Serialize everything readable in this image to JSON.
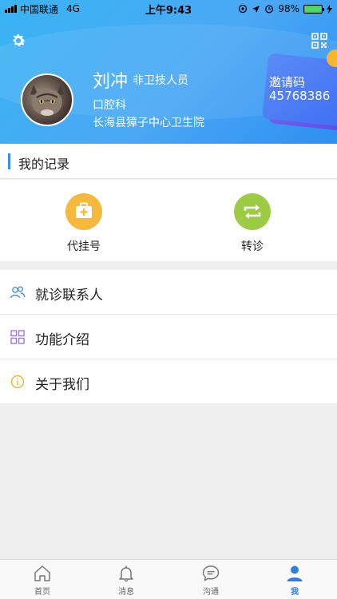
{
  "status_bar": {
    "carrier": "中国联通",
    "network": "4G",
    "time": "上午9:43",
    "battery": "98%",
    "battery_level": 0.98
  },
  "profile": {
    "name": "刘冲",
    "role": "非卫技人员",
    "department": "口腔科",
    "hospital": "长海县獐子中心卫生院"
  },
  "invite": {
    "label": "邀请码",
    "code": "45768386"
  },
  "records": {
    "title": "我的记录",
    "items": [
      {
        "label": "代挂号",
        "icon": "medical-kit-icon",
        "color": "#f6b93b"
      },
      {
        "label": "转诊",
        "icon": "transfer-icon",
        "color": "#9ccc44"
      }
    ]
  },
  "menu": [
    {
      "label": "就诊联系人",
      "icon": "contacts-icon",
      "color": "#4a90e2"
    },
    {
      "label": "功能介绍",
      "icon": "grid-icon",
      "color": "#9b7ae8"
    },
    {
      "label": "关于我们",
      "icon": "info-icon",
      "color": "#f0b232"
    }
  ],
  "tabs": [
    {
      "label": "首页",
      "icon": "home-icon"
    },
    {
      "label": "消息",
      "icon": "bell-icon"
    },
    {
      "label": "沟通",
      "icon": "chat-icon"
    },
    {
      "label": "我",
      "icon": "user-icon",
      "active": true
    }
  ],
  "colors": {
    "header": "#3aa9f4",
    "accent": "#2f7de1"
  }
}
